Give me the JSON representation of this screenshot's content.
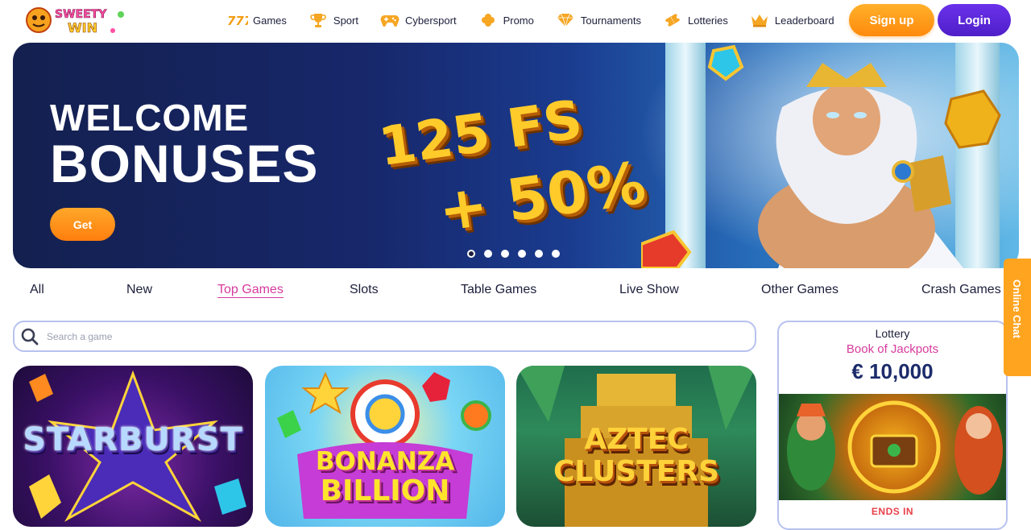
{
  "brand": {
    "logo_line1": "SWEETY",
    "logo_line2": "WIN"
  },
  "nav": {
    "items": [
      {
        "label": "Games",
        "icon": "slot-777-icon"
      },
      {
        "label": "Sport",
        "icon": "trophy-icon"
      },
      {
        "label": "Cybersport",
        "icon": "gamepad-icon"
      },
      {
        "label": "Promo",
        "icon": "clover-icon"
      },
      {
        "label": "Tournaments",
        "icon": "diamond-icon"
      },
      {
        "label": "Lotteries",
        "icon": "lottery-ticket-icon"
      },
      {
        "label": "Leaderboard",
        "icon": "crown-icon"
      }
    ]
  },
  "auth": {
    "signup_label": "Sign up",
    "login_label": "Login"
  },
  "hero": {
    "title_line1": "WELCOME",
    "title_line2": "BONUSES",
    "offer_line1": "125 FS",
    "offer_line2": "+ 50%",
    "cta_label": "Get",
    "slides_count": 6,
    "active_slide": 1
  },
  "tabs": [
    "All",
    "New",
    "Top Games",
    "Slots",
    "Table Games",
    "Live Show",
    "Other Games",
    "Crash Games"
  ],
  "active_tab": "Top Games",
  "search": {
    "placeholder": "Search a game"
  },
  "games": [
    {
      "title_line1": "STARBURST",
      "title_line2": ""
    },
    {
      "title_line1": "BONANZA",
      "title_line2": "BILLION"
    },
    {
      "title_line1": "AZTEC",
      "title_line2": "CLUSTERS"
    }
  ],
  "lottery": {
    "label": "Lottery",
    "name": "Book of Jackpots",
    "amount": "€ 10,000",
    "ends_label": "ENDS IN"
  },
  "chat": {
    "label": "Online Chat"
  },
  "colors": {
    "accent_pink": "#d63b9c",
    "signup_orange": "#ff8a0c",
    "login_purple": "#5a25d6",
    "hero_navy": "#17276a"
  }
}
